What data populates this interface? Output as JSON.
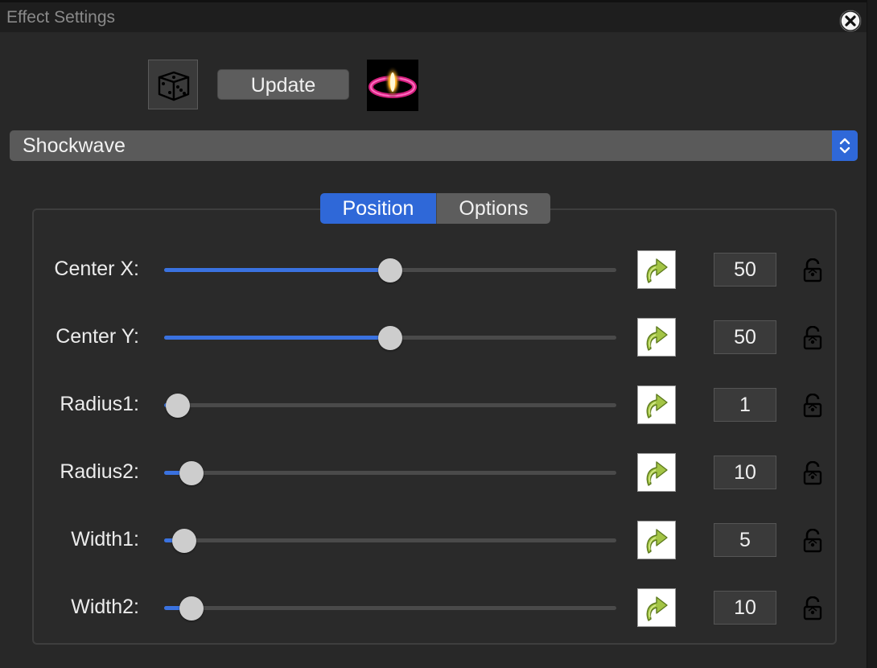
{
  "window": {
    "title": "Effect Settings"
  },
  "toolbar": {
    "update_label": "Update",
    "randomize_icon": "dice-icon",
    "preview_icon": "shockwave-preview"
  },
  "effect_select": {
    "value": "Shockwave"
  },
  "tabs": [
    {
      "label": "Position",
      "active": true
    },
    {
      "label": "Options",
      "active": false
    }
  ],
  "params": [
    {
      "label": "Center X:",
      "value": "50",
      "fraction": 0.5
    },
    {
      "label": "Center Y:",
      "value": "50",
      "fraction": 0.5
    },
    {
      "label": "Radius1:",
      "value": "1",
      "fraction": 0.03
    },
    {
      "label": "Radius2:",
      "value": "10",
      "fraction": 0.06
    },
    {
      "label": "Width1:",
      "value": "5",
      "fraction": 0.045
    },
    {
      "label": "Width2:",
      "value": "10",
      "fraction": 0.06
    }
  ],
  "colors": {
    "accent": "#2f68d8",
    "background": "#282828",
    "button": "#5d5d5d"
  }
}
